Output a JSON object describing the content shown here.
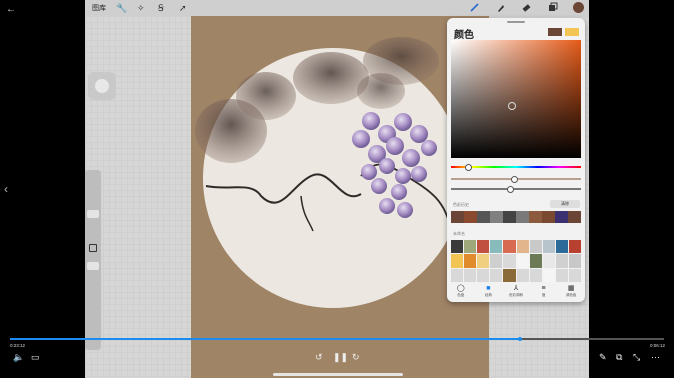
{
  "player": {
    "back_glyph": "←",
    "current_time": "0:23:12",
    "total_time": "0:06:12",
    "progress_fraction": 0.78,
    "controls": {
      "rewind_glyph": "↺",
      "pause_glyph": "❚❚",
      "forward_glyph": "↻",
      "volume_glyph": "🔈",
      "subtitle_glyph": "▭",
      "edit_glyph": "✎",
      "pip_glyph": "⧉",
      "collapse_glyph": "⤡",
      "more_glyph": "⋯",
      "left_arrow_glyph": "‹"
    }
  },
  "toolbar": {
    "gallery_label": "图库",
    "actions_icon": "wrench-icon",
    "adjust_icon": "magic-wand-icon",
    "selection_icon": "selection-icon",
    "transform_icon": "arrow-cursor-icon",
    "brush_icon": "brush-icon",
    "smudge_icon": "smudge-icon",
    "eraser_icon": "eraser-icon",
    "layers_icon": "layers-icon",
    "active_color": "#6b4637"
  },
  "color_panel": {
    "title": "颜色",
    "primary_color": "#6b4637",
    "secondary_color": "#f2c453",
    "history_label": "色彩历史",
    "clear_label": "清除",
    "palette_label": "未命名",
    "history_colors": [
      "#6b4637",
      "#8a4a30",
      "#555555",
      "#808080",
      "#444444",
      "#7a7a7a",
      "#8c5a3c",
      "#7a4a30",
      "#3b3070",
      "#6b4637"
    ],
    "palette_colors": [
      "#3a3a3a",
      "#9fa87a",
      "#c25040",
      "#88bcbc",
      "#d76a50",
      "#e3b58c",
      "#c9c9c9",
      "#b8c4cc",
      "#2c6a9a",
      "#b84030",
      "#f2c453",
      "#e08b2c",
      "#f0d080",
      "#cfcfcf",
      "#d9d9d9",
      "#f5f5f5",
      "#6c7a55",
      "#e8e8e8",
      "#d0d0d0",
      "#c8c8c8",
      "#d8d8d8",
      "#d8d8d8",
      "#d8d8d8",
      "#d8d8d8",
      "#8b6a3a",
      "#d8d8d8",
      "#d8d8d8",
      "#f5f5f5",
      "#d8d8d8",
      "#d8d8d8"
    ],
    "tabs": [
      {
        "icon": "◯",
        "label": "色盘"
      },
      {
        "icon": "■",
        "label": "经典"
      },
      {
        "icon": "⅄",
        "label": "色彩调和"
      },
      {
        "icon": "≡",
        "label": "值"
      },
      {
        "icon": "▦",
        "label": "调色板"
      }
    ],
    "active_tab": 1
  }
}
